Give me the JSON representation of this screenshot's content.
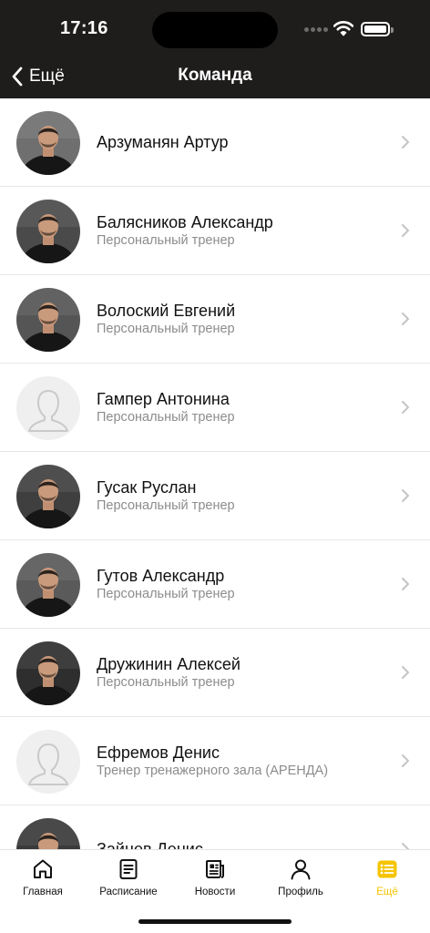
{
  "status_bar": {
    "time": "17:16"
  },
  "nav": {
    "back_label": "Ещё",
    "title": "Команда"
  },
  "team": [
    {
      "name": "Арзуманян Артур",
      "role": "",
      "photo": "photo"
    },
    {
      "name": "Балясников Александр",
      "role": "Персональный тренер",
      "photo": "photo"
    },
    {
      "name": "Волоский Евгений",
      "role": "Персональный тренер",
      "photo": "photo"
    },
    {
      "name": "Гампер Антонина",
      "role": "Персональный тренер",
      "photo": "placeholder"
    },
    {
      "name": "Гусак Руслан",
      "role": "Персональный тренер",
      "photo": "photo"
    },
    {
      "name": "Гутов Александр",
      "role": "Персональный тренер",
      "photo": "photo"
    },
    {
      "name": "Дружинин Алексей",
      "role": "Персональный тренер",
      "photo": "photo"
    },
    {
      "name": "Ефремов Денис",
      "role": "Тренер тренажерного зала (АРЕНДА)",
      "photo": "placeholder"
    },
    {
      "name": "Зайцев Денис",
      "role": "",
      "photo": "photo"
    }
  ],
  "tabbar": {
    "tabs": [
      {
        "label": "Главная",
        "icon": "home-icon"
      },
      {
        "label": "Расписание",
        "icon": "schedule-icon"
      },
      {
        "label": "Новости",
        "icon": "news-icon"
      },
      {
        "label": "Профиль",
        "icon": "profile-icon"
      },
      {
        "label": "Ещё",
        "icon": "more-icon"
      }
    ],
    "active": "Ещё"
  },
  "colors": {
    "header_bg": "#1f1d1c",
    "accent": "#f5c400",
    "subtitle": "#8c8c8c"
  }
}
